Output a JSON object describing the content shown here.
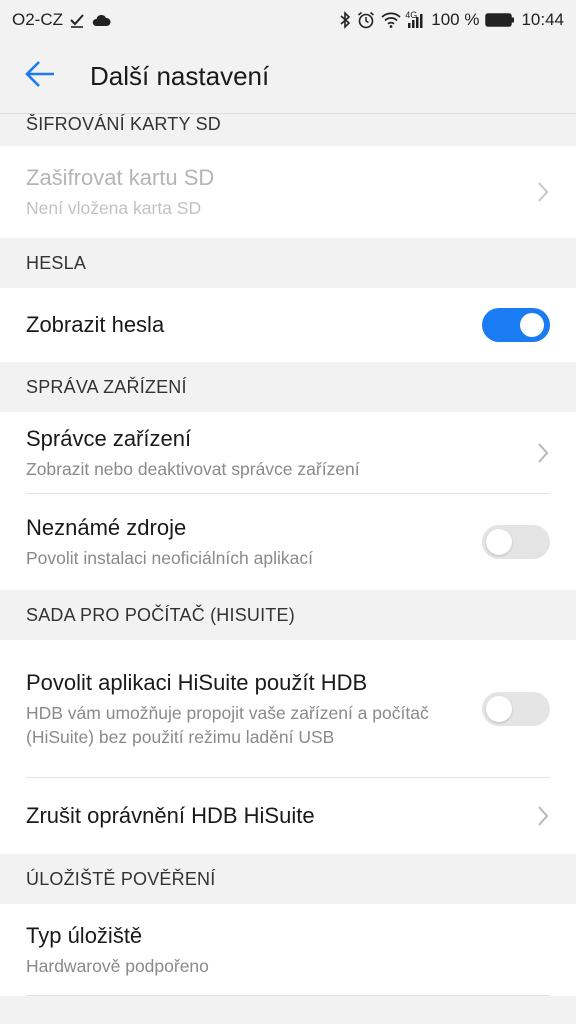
{
  "status_bar": {
    "carrier": "O2-CZ",
    "battery_percent": "100 %",
    "time": "10:44",
    "network": "4G",
    "icons": [
      "check-icon",
      "cloud-icon",
      "bluetooth-icon",
      "alarm-icon",
      "wifi-icon",
      "signal-icon",
      "battery-icon"
    ]
  },
  "header": {
    "title": "Další nastavení",
    "back_icon": "arrow-left-icon",
    "accent": "#1a7cf3"
  },
  "sections": {
    "sd": {
      "header": "ŠIFROVÁNÍ KARTY SD",
      "encrypt": {
        "title": "Zašifrovat kartu SD",
        "subtitle": "Není vložena karta SD"
      }
    },
    "passwords": {
      "header": "HESLA",
      "show": {
        "title": "Zobrazit hesla",
        "state": "on"
      }
    },
    "device": {
      "header": "SPRÁVA ZAŘÍZENÍ",
      "admins": {
        "title": "Správce zařízení",
        "subtitle": "Zobrazit nebo deaktivovat správce zařízení"
      },
      "unknown": {
        "title": "Neznámé zdroje",
        "subtitle": "Povolit instalaci neoficiálních aplikací",
        "state": "off"
      }
    },
    "hisuite": {
      "header": "SADA PRO POČÍTAČ (HISUITE)",
      "hdb": {
        "title": "Povolit aplikaci HiSuite použít HDB",
        "subtitle": "HDB vám umožňuje propojit vaše zařízení a počítač (HiSuite) bez použití režimu ladění USB",
        "state": "off"
      },
      "revoke": {
        "title": "Zrušit oprávnění HDB HiSuite"
      }
    },
    "credentials": {
      "header": "ÚLOŽIŠTĚ POVĚŘENÍ",
      "storage": {
        "title": "Typ úložiště",
        "subtitle": "Hardwarově podpořeno"
      }
    }
  }
}
